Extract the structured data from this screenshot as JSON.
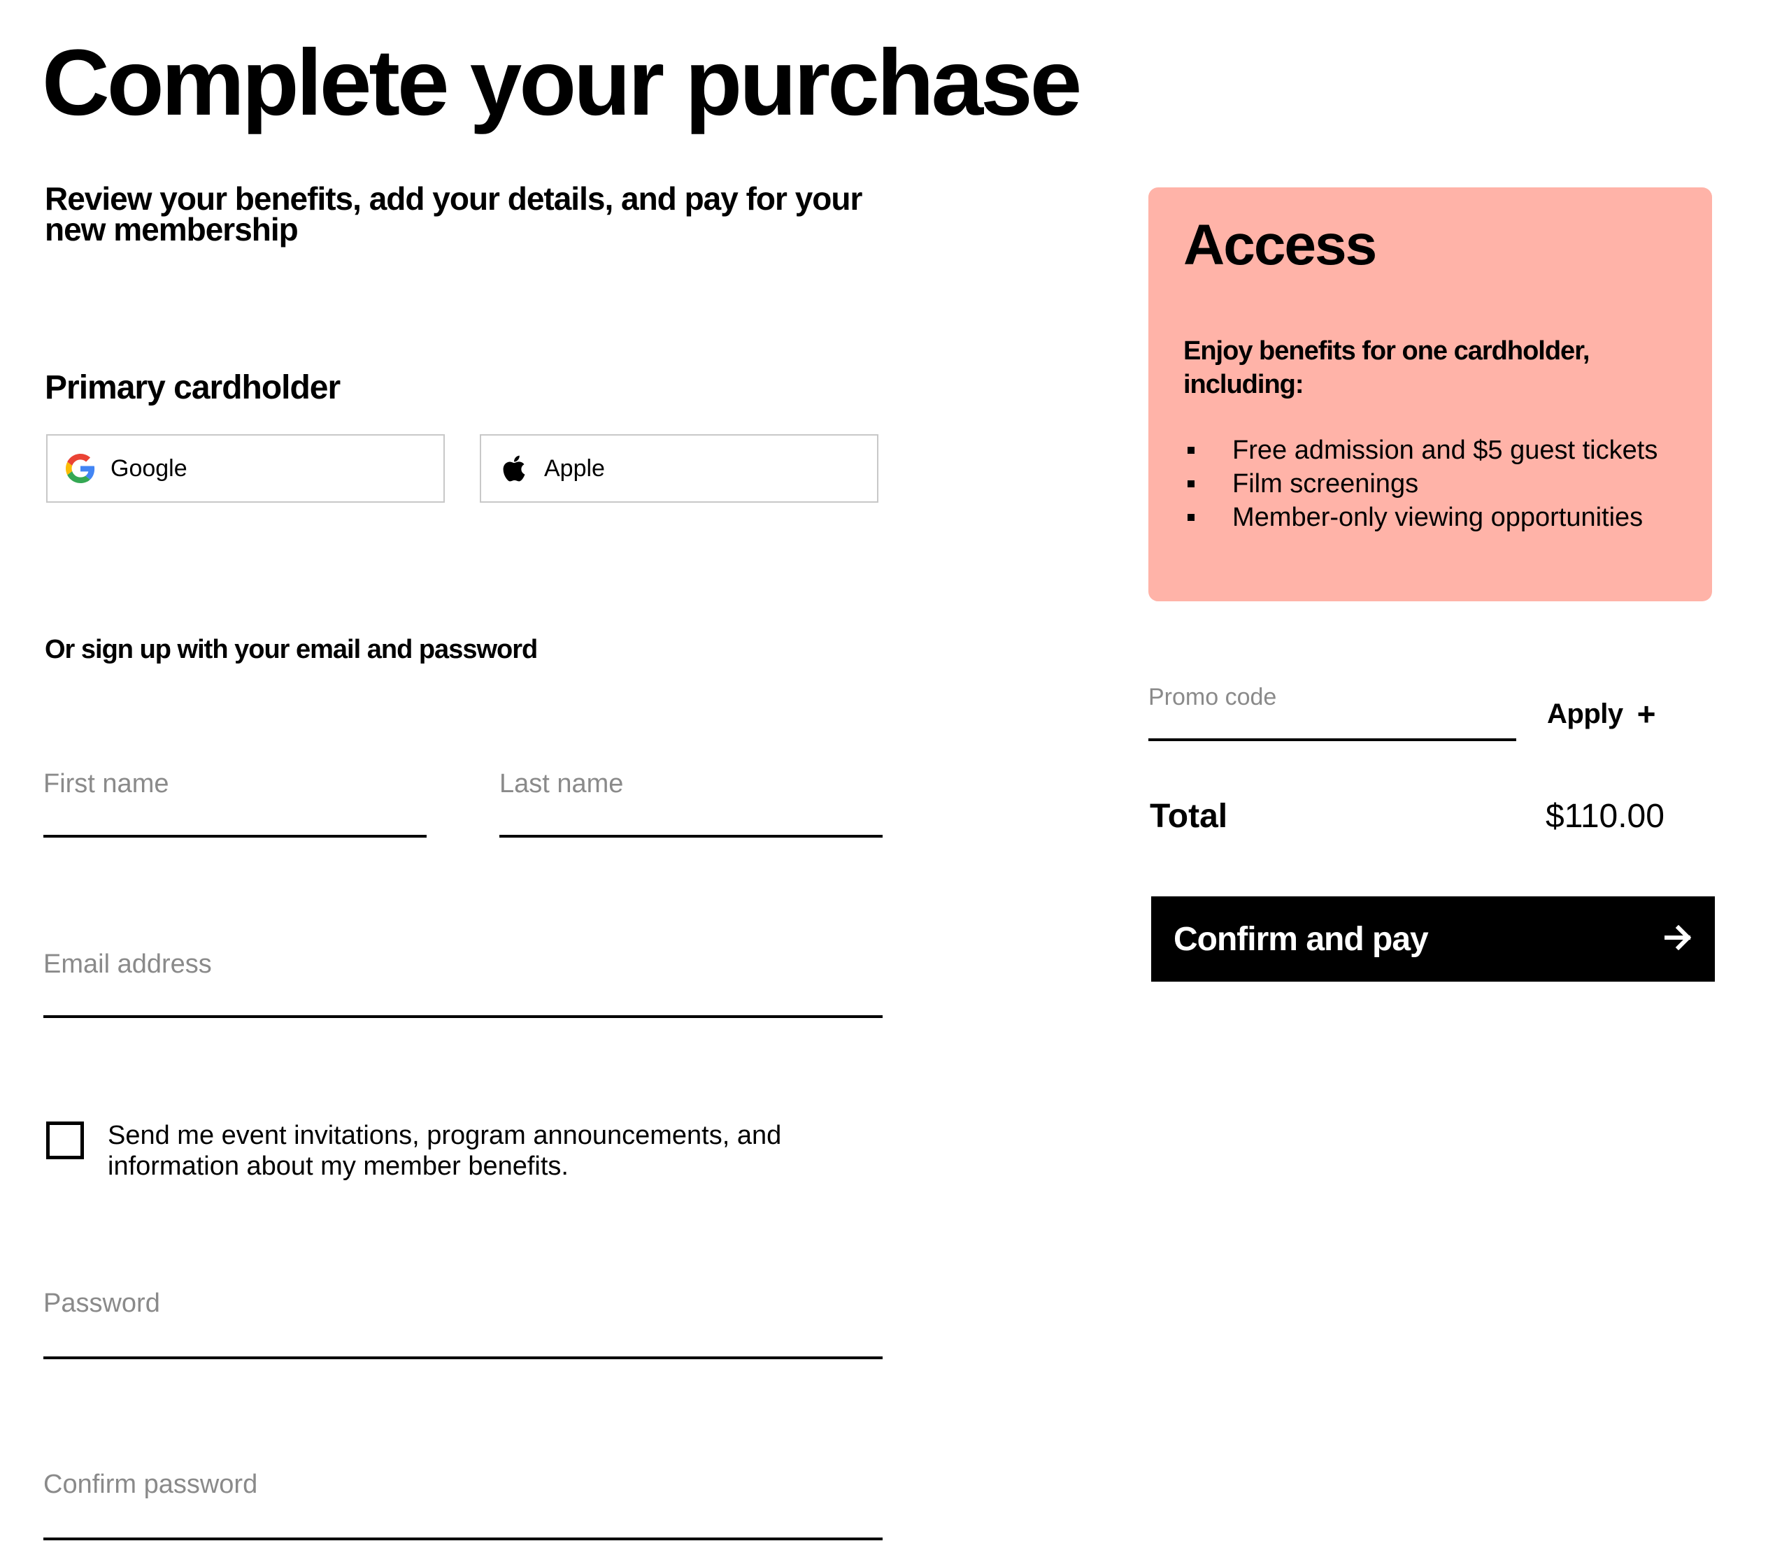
{
  "page": {
    "title": "Complete your purchase",
    "subtitle": "Review your benefits, add your details, and pay for your new membership"
  },
  "form": {
    "section_title": "Primary cardholder",
    "google_label": "Google",
    "apple_label": "Apple",
    "or_text": "Or sign up with your email and password",
    "first_name_placeholder": "First name",
    "last_name_placeholder": "Last name",
    "email_placeholder": "Email address",
    "newsletter_label": "Send me event invitations, program announcements, and information about my member benefits.",
    "newsletter_checked": false,
    "password_placeholder": "Password",
    "confirm_password_placeholder": "Confirm password"
  },
  "membership": {
    "name": "Access",
    "benefits_intro": "Enjoy benefits for one cardholder, including:",
    "benefits": [
      "Free admission and $5 guest tickets",
      "Film screenings",
      "Member-only viewing opportunities"
    ],
    "card_color": "#ffb3a8"
  },
  "checkout": {
    "promo_placeholder": "Promo code",
    "apply_label": "Apply",
    "total_label": "Total",
    "total_value": "$110.00",
    "pay_label": "Confirm and pay"
  },
  "icons": {
    "google": "google-logo-icon",
    "apple": "apple-logo-icon",
    "apply": "plus-icon",
    "pay": "arrow-right-icon"
  }
}
